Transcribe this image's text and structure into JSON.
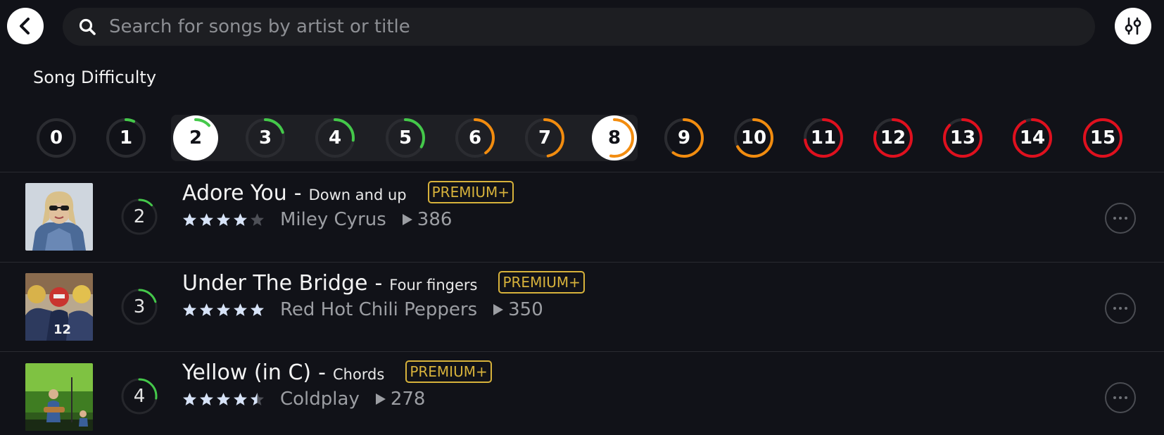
{
  "search": {
    "placeholder": "Search for songs by artist or title"
  },
  "filters": {
    "section_title": "Song Difficulty",
    "levels": [
      {
        "label": "0",
        "progress": 0.0,
        "color": "#44c84a"
      },
      {
        "label": "1",
        "progress": 0.07,
        "color": "#44c84a"
      },
      {
        "label": "2",
        "progress": 0.13,
        "color": "#44c84a"
      },
      {
        "label": "3",
        "progress": 0.2,
        "color": "#44c84a"
      },
      {
        "label": "4",
        "progress": 0.27,
        "color": "#44c84a"
      },
      {
        "label": "5",
        "progress": 0.33,
        "color": "#44c84a"
      },
      {
        "label": "6",
        "progress": 0.4,
        "color": "#f28c0f"
      },
      {
        "label": "7",
        "progress": 0.47,
        "color": "#f28c0f"
      },
      {
        "label": "8",
        "progress": 0.53,
        "color": "#f28c0f"
      },
      {
        "label": "9",
        "progress": 0.6,
        "color": "#f28c0f"
      },
      {
        "label": "10",
        "progress": 0.67,
        "color": "#f28c0f"
      },
      {
        "label": "11",
        "progress": 0.73,
        "color": "#e0101e"
      },
      {
        "label": "12",
        "progress": 0.8,
        "color": "#e0101e"
      },
      {
        "label": "13",
        "progress": 0.87,
        "color": "#e0101e"
      },
      {
        "label": "14",
        "progress": 0.93,
        "color": "#e0101e"
      },
      {
        "label": "15",
        "progress": 1.0,
        "color": "#e0101e"
      }
    ],
    "selected_range": [
      "2",
      "8"
    ]
  },
  "songs": [
    {
      "title": "Adore You",
      "separator": "-",
      "version": "Down and up",
      "badge": "PREMIUM+",
      "artist": "Miley Cyrus",
      "plays": "386",
      "rating": 4,
      "level": "2",
      "level_progress": 0.13
    },
    {
      "title": "Under The Bridge",
      "separator": "-",
      "version": "Four fingers",
      "badge": "PREMIUM+",
      "artist": "Red Hot Chili Peppers",
      "plays": "350",
      "rating": 5,
      "level": "3",
      "level_progress": 0.2
    },
    {
      "title": "Yellow (in C)",
      "separator": "-",
      "version": "Chords",
      "badge": "PREMIUM+",
      "artist": "Coldplay",
      "plays": "278",
      "rating": 4.5,
      "level": "4",
      "level_progress": 0.27
    }
  ],
  "icons": {
    "back": "chevron-left-icon",
    "search": "search-icon",
    "filter": "sliders-icon",
    "play": "play-icon",
    "more": "more-horizontal-icon",
    "star": "star-icon"
  },
  "colors": {
    "background": "#111218",
    "search_bg": "#1d1e22",
    "premium": "#d7b23b",
    "star_filled": "#d7e3f7",
    "star_empty": "#4e5057",
    "easy": "#44c84a",
    "medium": "#f28c0f",
    "hard": "#e0101e"
  }
}
